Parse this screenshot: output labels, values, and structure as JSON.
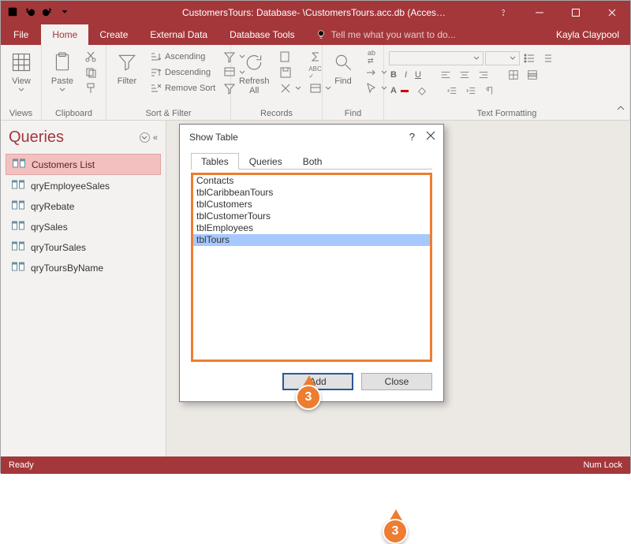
{
  "titlebar": {
    "title": "CustomersTours: Database- \\CustomersTours.acc.db (Acces…",
    "user": "Kayla Claypool"
  },
  "menubar": {
    "file": "File",
    "home": "Home",
    "create": "Create",
    "external": "External Data",
    "dbtools": "Database Tools",
    "tellme": "Tell me what you want to do..."
  },
  "ribbon": {
    "views": {
      "label": "Views",
      "view": "View"
    },
    "clipboard": {
      "label": "Clipboard",
      "paste": "Paste"
    },
    "sortfilter": {
      "label": "Sort & Filter",
      "filter": "Filter",
      "asc": "Ascending",
      "desc": "Descending",
      "remove": "Remove Sort"
    },
    "records": {
      "label": "Records",
      "refresh": "Refresh\nAll"
    },
    "find": {
      "label": "Find",
      "find": "Find"
    },
    "textfmt": {
      "label": "Text Formatting"
    }
  },
  "nav": {
    "title": "Queries",
    "items": [
      "Customers List",
      "qryEmployeeSales",
      "qryRebate",
      "qrySales",
      "qryTourSales",
      "qryToursByName"
    ]
  },
  "dialog": {
    "title": "Show Table",
    "tabs": {
      "tables": "Tables",
      "queries": "Queries",
      "both": "Both"
    },
    "list": [
      "Contacts",
      "tblCaribbeanTours",
      "tblCustomers",
      "tblCustomerTours",
      "tblEmployees",
      "tblTours"
    ],
    "selected": "tblTours",
    "add": "Add",
    "close": "Close"
  },
  "callouts": {
    "c1": "3",
    "c2": "3"
  },
  "status": {
    "left": "Ready",
    "right": "Num Lock"
  }
}
